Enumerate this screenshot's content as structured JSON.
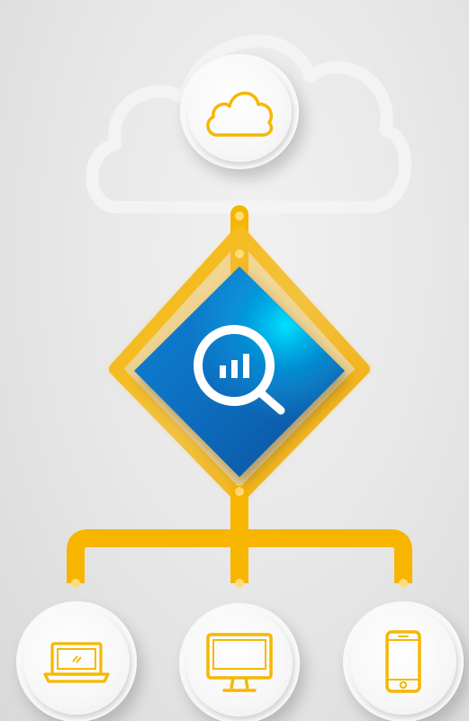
{
  "diagram": {
    "nodes": [
      {
        "id": "cloud",
        "icon": "cloud-icon",
        "role": "source"
      },
      {
        "id": "analytics",
        "icon": "analytics-search-icon",
        "role": "hub"
      },
      {
        "id": "laptop",
        "icon": "laptop-icon",
        "role": "endpoint"
      },
      {
        "id": "desktop",
        "icon": "desktop-monitor-icon",
        "role": "endpoint"
      },
      {
        "id": "phone",
        "icon": "smartphone-icon",
        "role": "endpoint"
      }
    ],
    "edges": [
      {
        "from": "cloud",
        "to": "analytics"
      },
      {
        "from": "analytics",
        "to": "laptop"
      },
      {
        "from": "analytics",
        "to": "desktop"
      },
      {
        "from": "analytics",
        "to": "phone"
      }
    ]
  },
  "colors": {
    "connector": "#f7b500",
    "icon_stroke": "#f5b800",
    "hub_blue": "#0b6fc1",
    "hub_highlight": "#00d8ff",
    "background": "#e8e8e8"
  }
}
